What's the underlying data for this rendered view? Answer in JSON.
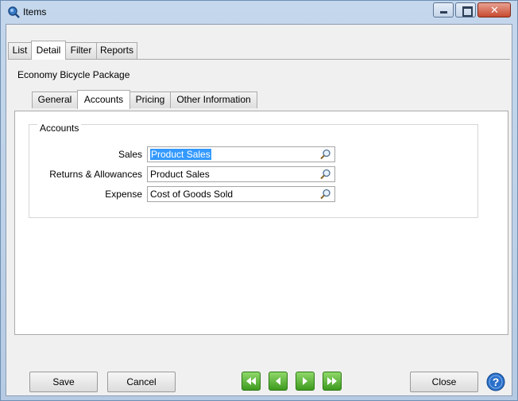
{
  "window": {
    "title": "Items",
    "controls": {
      "minimize_icon": "minimize-icon",
      "maximize_icon": "maximize-icon",
      "close_icon": "close-icon"
    }
  },
  "main_tabs": [
    {
      "label": "List",
      "active": false
    },
    {
      "label": "Detail",
      "active": true
    },
    {
      "label": "Filter",
      "active": false
    },
    {
      "label": "Reports",
      "active": false
    }
  ],
  "detail": {
    "record_title": "Economy Bicycle Package",
    "sub_tabs": [
      {
        "label": "General",
        "active": false
      },
      {
        "label": "Accounts",
        "active": true
      },
      {
        "label": "Pricing",
        "active": false
      },
      {
        "label": "Other Information",
        "active": false
      }
    ],
    "accounts_group": {
      "title": "Accounts",
      "fields": [
        {
          "label": "Sales",
          "value": "Product Sales",
          "selected": true,
          "icon": "magnifier-icon"
        },
        {
          "label": "Returns & Allowances",
          "value": "Product Sales",
          "selected": false,
          "icon": "magnifier-icon"
        },
        {
          "label": "Expense",
          "value": "Cost of Goods Sold",
          "selected": false,
          "icon": "magnifier-icon"
        }
      ]
    }
  },
  "footer": {
    "save_label": "Save",
    "cancel_label": "Cancel",
    "close_label": "Close",
    "nav_icons": [
      "first-record-icon",
      "previous-record-icon",
      "next-record-icon",
      "last-record-icon"
    ],
    "help_icon": "help-icon"
  },
  "colors": {
    "frame": "#b9cde5",
    "selection": "#3399ff",
    "nav_green": "#4caf2a",
    "help_blue": "#2a6fc9",
    "close_red": "#c74a30"
  }
}
